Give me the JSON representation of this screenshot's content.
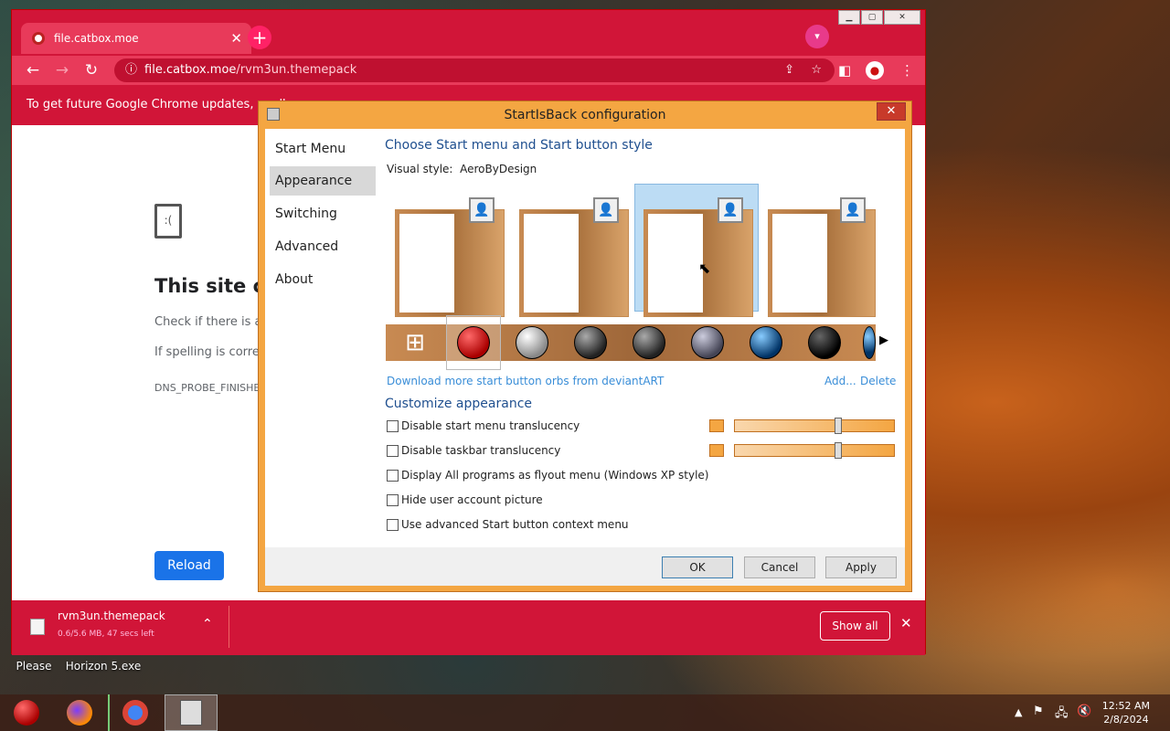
{
  "desktop": {
    "icons": [
      {
        "line1": "Please"
      },
      {
        "line1": "Horizon 5.exe"
      }
    ]
  },
  "chrome": {
    "tab_title": "file.catbox.moe",
    "url_host": "file.catbox.moe",
    "url_path": "/rvm3un.themepack",
    "infobar": "To get future Google Chrome updates, you'l",
    "error": {
      "title": "This site ca",
      "line1": "Check if there is a",
      "line2": "If spelling is corre",
      "code": "DNS_PROBE_FINISHE",
      "reload": "Reload"
    },
    "download": {
      "filename": "rvm3un.themepack",
      "status": "0.6/5.6 MB, 47 secs left",
      "show_all": "Show all"
    }
  },
  "dialog": {
    "title": "StartIsBack configuration",
    "sidebar": [
      "Start Menu",
      "Appearance",
      "Switching",
      "Advanced",
      "About"
    ],
    "heading1": "Choose Start menu and Start button style",
    "visual_style_label": "Visual style:",
    "visual_style_value": "AeroByDesign",
    "download_link": "Download more start button orbs from deviantART",
    "add_link": "Add...",
    "delete_link": "Delete",
    "heading2": "Customize appearance",
    "options": [
      "Disable start menu translucency",
      "Disable taskbar translucency",
      "Display All programs as flyout menu (Windows XP style)",
      "Hide user account picture",
      "Use advanced Start button context menu"
    ],
    "ok": "OK",
    "cancel": "Cancel",
    "apply": "Apply",
    "accent": "#f4a642",
    "translucency_start_menu": 0.65,
    "translucency_taskbar": 0.65
  },
  "taskbar": {
    "time": "12:52 AM",
    "date": "2/8/2024"
  }
}
